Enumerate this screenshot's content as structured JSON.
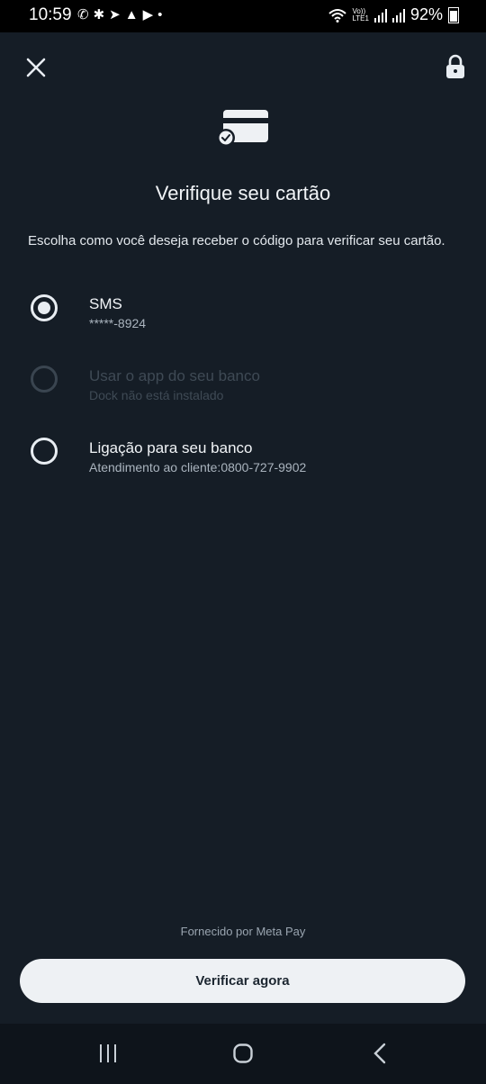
{
  "status_bar": {
    "time": "10:59",
    "battery": "92%",
    "volte": "Vo))\nLTE1"
  },
  "header": {
    "close_icon": "close-icon",
    "lock_icon": "lock-icon"
  },
  "main": {
    "title": "Verifique seu cartão",
    "subtitle": "Escolha como você deseja receber o código para verificar seu cartão.",
    "options": [
      {
        "title": "SMS",
        "detail": "*****-8924",
        "selected": true,
        "enabled": true
      },
      {
        "title": "Usar o app do seu banco",
        "detail": "Dock não está instalado",
        "selected": false,
        "enabled": false
      },
      {
        "title": "Ligação para seu banco",
        "detail": "Atendimento ao cliente:0800-727-9902",
        "selected": false,
        "enabled": true
      }
    ]
  },
  "footer": {
    "powered_by": "Fornecido por Meta Pay",
    "verify_button": "Verificar agora"
  },
  "colors": {
    "background": "#151d26",
    "button_bg": "#eef1f4",
    "text": "#e8edf2"
  }
}
